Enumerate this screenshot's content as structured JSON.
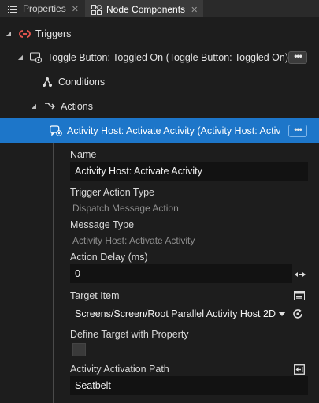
{
  "tabs": [
    {
      "label": "Properties",
      "icon": "list-icon",
      "close": "✕"
    },
    {
      "label": "Node Components",
      "icon": "component-icon",
      "close": "✕"
    }
  ],
  "tree": {
    "triggers": {
      "label": "Triggers",
      "icon": "trigger-icon"
    },
    "toggle": {
      "label": "Toggle Button: Toggled On (Toggle Button: Toggled On)",
      "icon": "toggle-trigger-icon",
      "more": "•••"
    },
    "conditions": {
      "label": "Conditions",
      "icon": "conditions-icon"
    },
    "actions": {
      "label": "Actions",
      "icon": "actions-icon"
    },
    "activity": {
      "label": "Activity Host: Activate Activity (Activity Host: Activate Activity)",
      "icon": "action-message-icon",
      "more": "•••"
    }
  },
  "properties": {
    "name_label": "Name",
    "name_value": "Activity Host: Activate Activity",
    "trigger_action_type_label": "Trigger Action Type",
    "trigger_action_type_value": "Dispatch Message Action",
    "message_type_label": "Message Type",
    "message_type_value": "Activity Host: Activate Activity",
    "action_delay_label": "Action Delay (ms)",
    "action_delay_value": "0",
    "target_item_label": "Target Item",
    "target_item_value": "Screens/Screen/Root Parallel Activity Host 2D",
    "define_target_label": "Define Target with Property",
    "define_target_checked": false,
    "activation_path_label": "Activity Activation Path",
    "activation_path_value": "Seatbelt"
  },
  "colors": {
    "selection": "#1d76c9",
    "trigger_icon": "#e0534d",
    "background": "#1d1d1d"
  }
}
